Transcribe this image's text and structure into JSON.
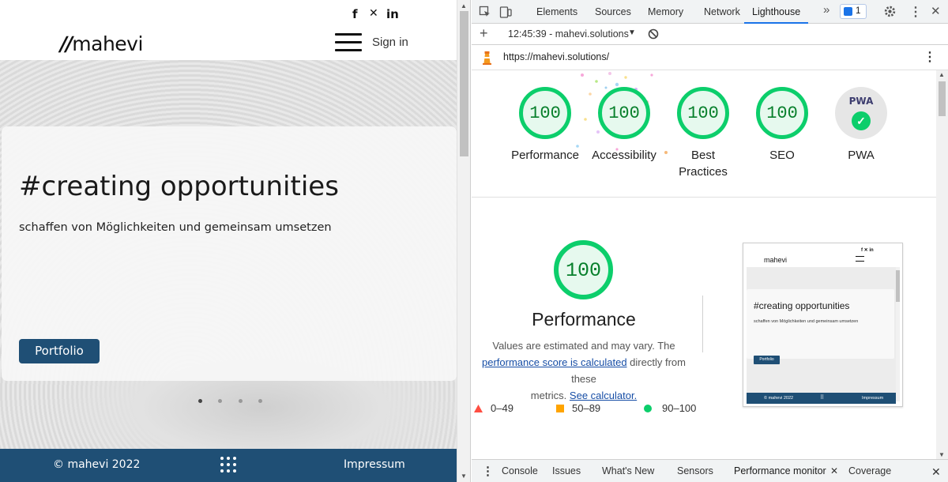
{
  "website": {
    "social": {
      "facebook": "f",
      "xing": "✕",
      "linkedin": "in"
    },
    "logo_mark": "∕∕",
    "logo": "mahevi",
    "signin": "Sign in",
    "headline": "#creating opportunities",
    "subtitle": "schaffen von Möglichkeiten und gemeinsam umsetzen",
    "portfolio_button": "Portfolio",
    "slider_active_index": 0,
    "slider_count": 4,
    "footer": {
      "copyright": "© mahevi 2022",
      "impressum": "Impressum"
    }
  },
  "devtools": {
    "tabs": [
      {
        "label": "Elements"
      },
      {
        "label": "Sources"
      },
      {
        "label": "Memory"
      },
      {
        "label": "Network"
      },
      {
        "label": "Lighthouse"
      }
    ],
    "more_tabs_icon": "»",
    "issues_count": "1",
    "report_selector": "12:45:39 - mahevi.solutions",
    "url": "https://mahevi.solutions/",
    "scores": [
      {
        "value": "100",
        "label": "Performance"
      },
      {
        "value": "100",
        "label": "Accessibility"
      },
      {
        "value": "100",
        "label": "Best Practices"
      },
      {
        "value": "100",
        "label": "SEO"
      }
    ],
    "pwa": {
      "badge": "PWA",
      "label": "PWA"
    },
    "performance": {
      "score": "100",
      "title": "Performance",
      "desc_1": "Values are estimated and may vary. The",
      "link_1": "performance score is calculated",
      "desc_2": "directly from these",
      "desc_3": "metrics.",
      "link_2": "See calculator."
    },
    "legend": {
      "fail": "0–49",
      "average": "50–89",
      "pass": "90–100"
    },
    "thumbnail": {
      "logo": "mahevi",
      "headline": "#creating opportunities",
      "subtitle": "schaffen von Möglichkeiten und gemeinsam umsetzen",
      "button": "Portfolio",
      "copyright": "© mahevi 2022",
      "impressum": "Impressum"
    },
    "drawer_tabs": [
      "Console",
      "Issues",
      "What's New",
      "Sensors",
      "Performance monitor",
      "Coverage"
    ],
    "active_drawer_tab": "Performance monitor",
    "colors": {
      "pass": "#0cce6b",
      "average": "#ffa400",
      "fail": "#ff4e42",
      "footer": "#1f4f75",
      "link": "#174ea6"
    }
  }
}
